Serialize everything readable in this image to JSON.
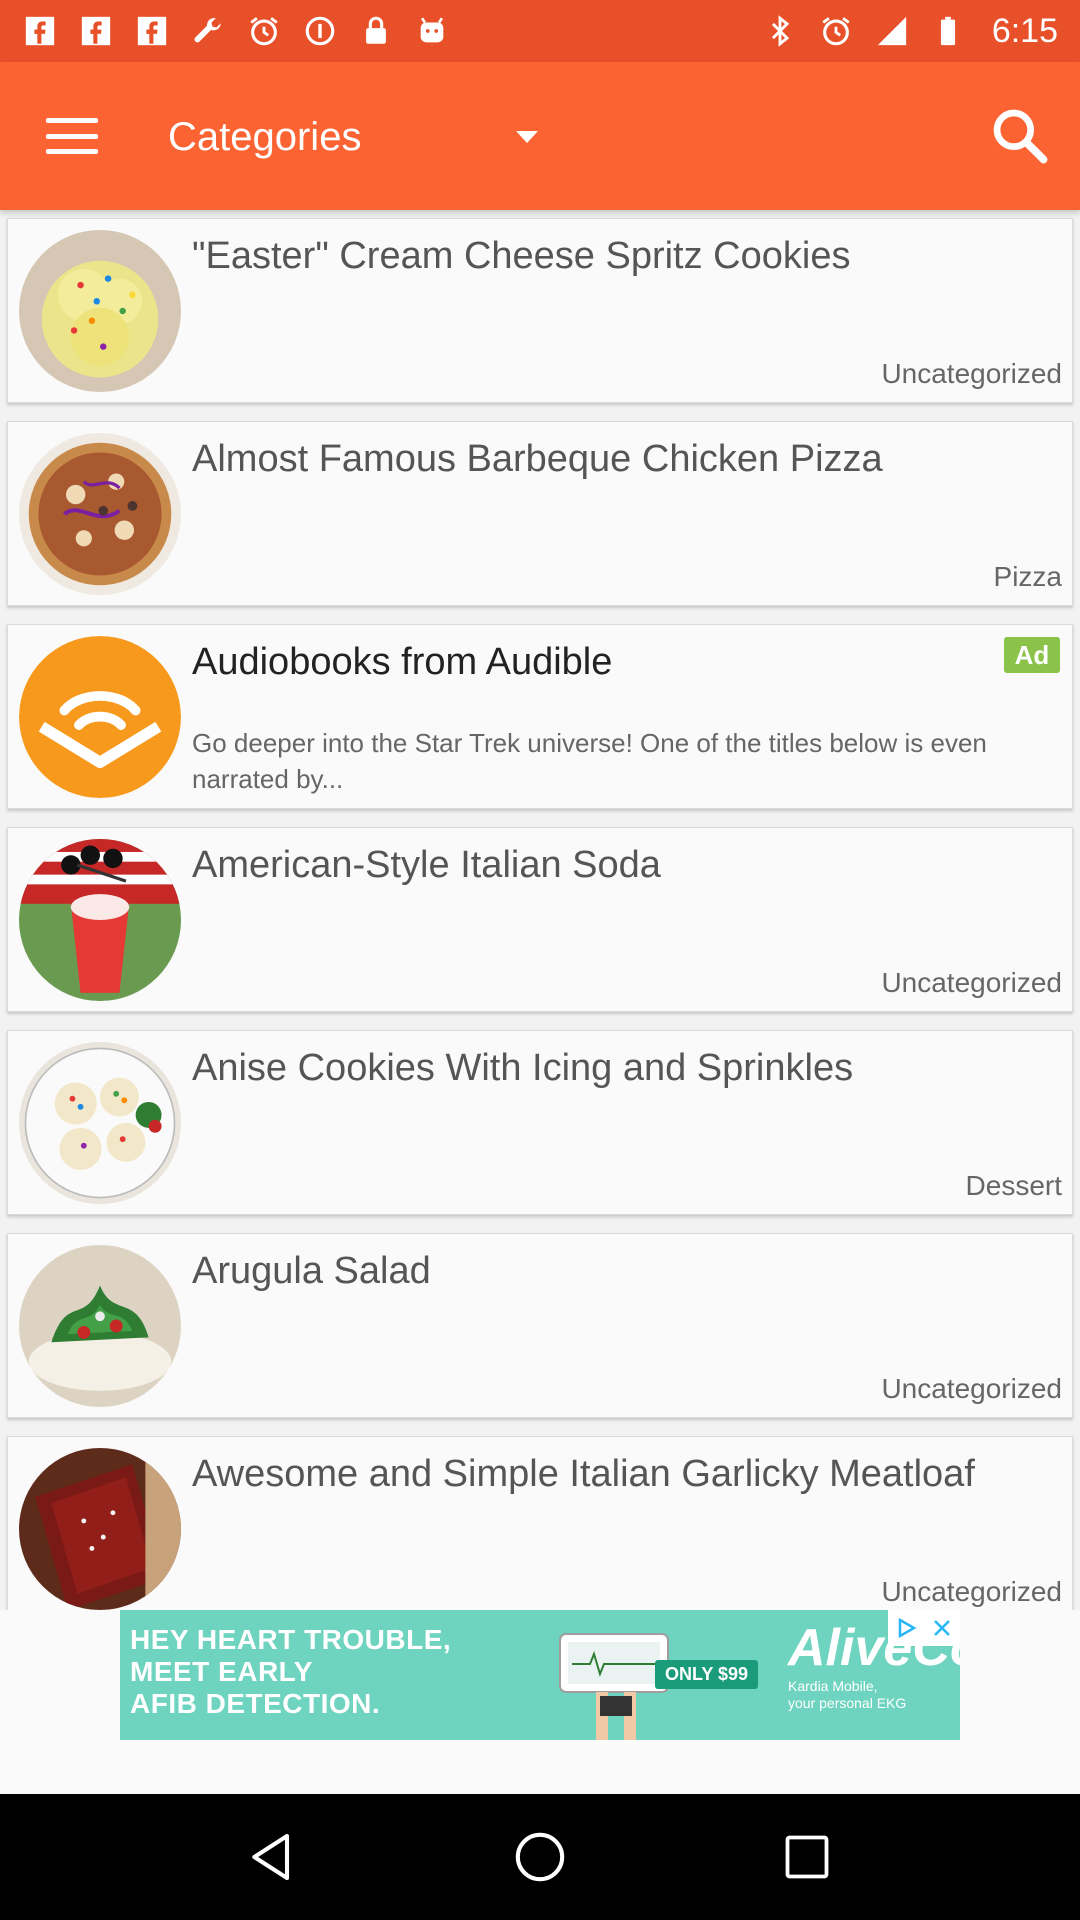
{
  "status_bar": {
    "time": "6:15",
    "left_icons": [
      "facebook-icon",
      "facebook-icon",
      "facebook-icon",
      "wrench-icon",
      "alarm-icon",
      "info-icon",
      "lock-icon",
      "android-icon"
    ],
    "right_icons": [
      "bluetooth-icon",
      "alarm-icon",
      "signal-icon",
      "battery-icon"
    ]
  },
  "app_bar": {
    "category_spinner": "Categories",
    "menu_icon": "menu-icon",
    "search_icon": "search-icon",
    "color": "#fb6432"
  },
  "recipes": [
    {
      "title": "\"Easter\" Cream Cheese Spritz Cookies",
      "category": "Uncategorized"
    },
    {
      "title": "Almost Famous Barbeque Chicken Pizza",
      "category": "Pizza"
    },
    {
      "title": "American-Style Italian Soda",
      "category": "Uncategorized"
    },
    {
      "title": "Anise Cookies With Icing and Sprinkles",
      "category": "Dessert"
    },
    {
      "title": "Arugula Salad",
      "category": "Uncategorized"
    },
    {
      "title": "Awesome and Simple Italian Garlicky Meatloaf",
      "category": "Uncategorized"
    }
  ],
  "native_ad": {
    "title": "Audiobooks from Audible",
    "badge": "Ad",
    "description": "Go deeper into the Star Trek universe! One of the titles below is even narrated by..."
  },
  "banner_ad": {
    "headline_line1": "HEY HEART TROUBLE,",
    "headline_line2": "MEET EARLY",
    "headline_line3": "AFIB DETECTION.",
    "price": "ONLY $99",
    "brand": "AliveCor",
    "sub_line1": "Kardia Mobile,",
    "sub_line2": "your personal EKG"
  }
}
